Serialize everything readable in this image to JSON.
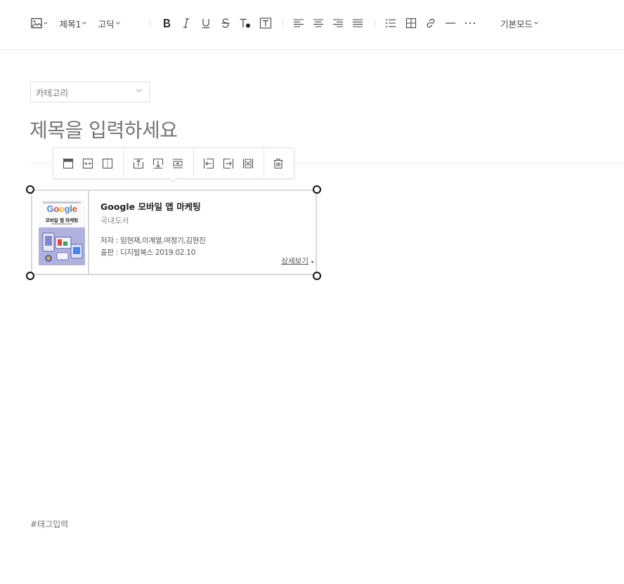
{
  "toolbar": {
    "heading_label": "제목1",
    "font_label": "고딕",
    "mode_label": "기본모드"
  },
  "category": {
    "placeholder": "카테고리"
  },
  "title": {
    "placeholder": "제목을 입력하세요"
  },
  "book_card": {
    "cover_google": "Google",
    "cover_subtitle": "모바일 앱 마케팅",
    "title": "Google 모바일 앱 마케팅",
    "category": "국내도서",
    "author": "저자 : 임현재,이계열,여정기,김현진",
    "publisher": "출판 : 디지털북스 2019.02.10",
    "more_label": "상세보기"
  },
  "tags": {
    "placeholder": "#태그입력"
  },
  "colors": {
    "google_blue": "#4285F4",
    "google_red": "#EA4335",
    "google_yellow": "#FBBC05",
    "google_green": "#34A853",
    "cover_art": "#aeb2dd"
  }
}
